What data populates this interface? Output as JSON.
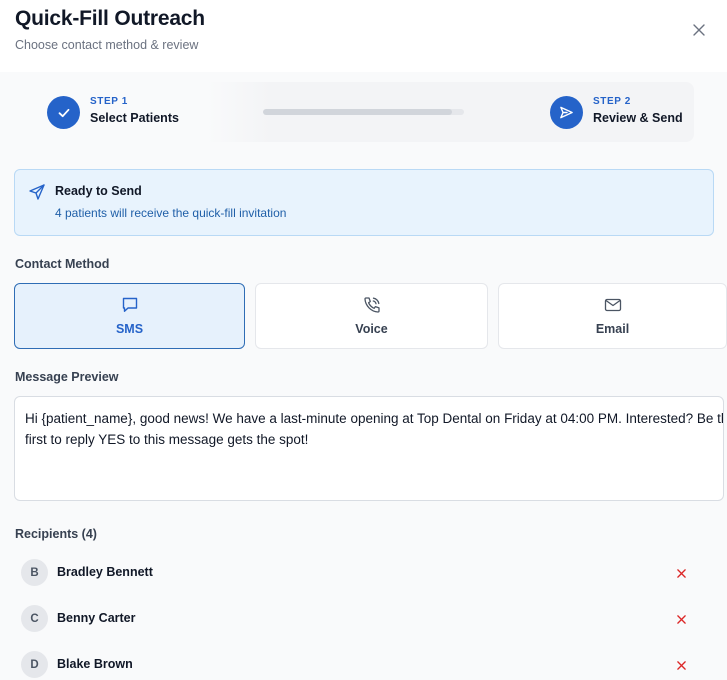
{
  "header": {
    "title": "Quick-Fill Outreach",
    "subtitle": "Choose contact method & review",
    "close_icon": "close-icon"
  },
  "stepper": {
    "steps": [
      {
        "tag": "STEP 1",
        "label": "Select Patients",
        "state": "completed",
        "icon": "check-icon"
      },
      {
        "tag": "STEP 2",
        "label": "Review & Send",
        "state": "active",
        "icon": "send-icon"
      }
    ],
    "progress_fraction": 0.94
  },
  "ready_banner": {
    "icon": "send-icon",
    "title": "Ready to Send",
    "subtitle": "4 patients will receive the quick-fill invitation"
  },
  "contact_method": {
    "label": "Contact Method",
    "selected": "SMS",
    "options": [
      {
        "label": "SMS",
        "icon": "chat-bubble-icon"
      },
      {
        "label": "Voice",
        "icon": "phone-icon"
      },
      {
        "label": "Email",
        "icon": "mail-icon"
      }
    ]
  },
  "message_preview": {
    "label": "Message Preview",
    "lines": [
      "Hi {patient_name}, good news! We have a last-minute opening at Top Dental on Friday at 04:00 PM. Interested? Be the",
      "first to reply YES to this message gets the spot!"
    ]
  },
  "recipients": {
    "label": "Recipients (4)",
    "items": [
      {
        "initial": "B",
        "name": "Bradley Bennett"
      },
      {
        "initial": "C",
        "name": "Benny Carter"
      },
      {
        "initial": "D",
        "name": "Blake Brown"
      }
    ]
  },
  "colors": {
    "accent": "#2563c9",
    "banner_bg": "#e8f3fd",
    "banner_border": "#b9d9f5",
    "remove": "#dc2626"
  }
}
